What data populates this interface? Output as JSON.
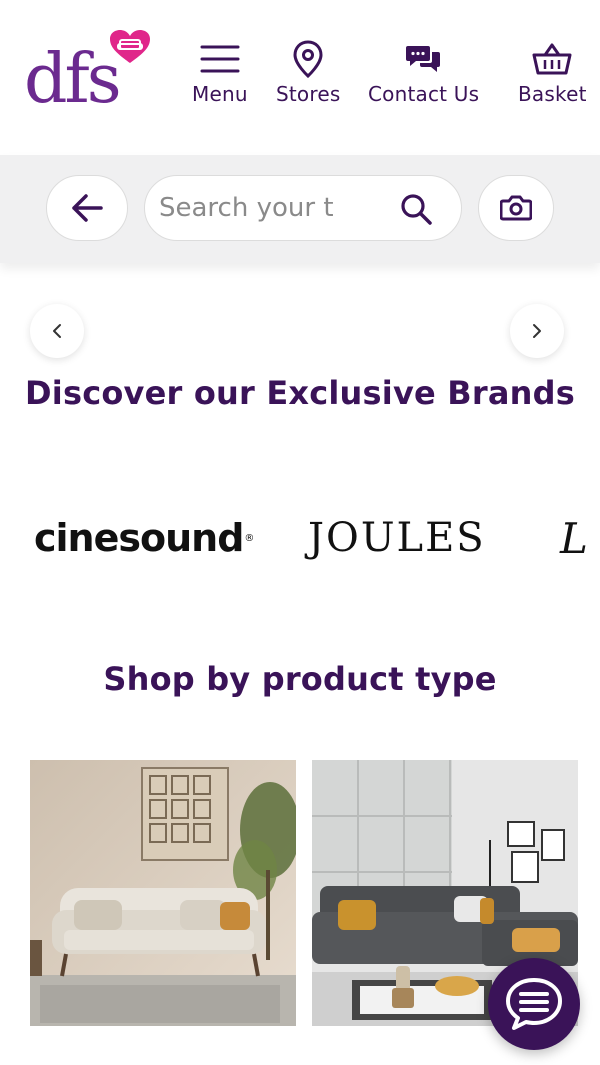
{
  "header": {
    "logo_text": "dfs",
    "nav": [
      {
        "label": "Menu",
        "icon": "menu-icon"
      },
      {
        "label": "Stores",
        "icon": "location-pin-icon"
      },
      {
        "label": "Contact Us",
        "icon": "chat-bubbles-icon"
      },
      {
        "label": "Basket",
        "icon": "basket-icon"
      }
    ]
  },
  "search": {
    "placeholder": "Search your t",
    "back_icon": "arrow-left-icon",
    "search_icon": "search-icon",
    "camera_icon": "camera-icon"
  },
  "brands_section": {
    "title": "Discover our Exclusive Brands",
    "brands": [
      "cinesound",
      "JOULES",
      "L"
    ]
  },
  "product_section": {
    "title": "Shop by product type"
  },
  "chat": {
    "icon": "chat-icon"
  },
  "colors": {
    "brand_purple": "#3a1358",
    "logo_purple": "#6b2a8f",
    "heart_pink": "#e0268a",
    "search_bg": "#f0f0f1"
  }
}
